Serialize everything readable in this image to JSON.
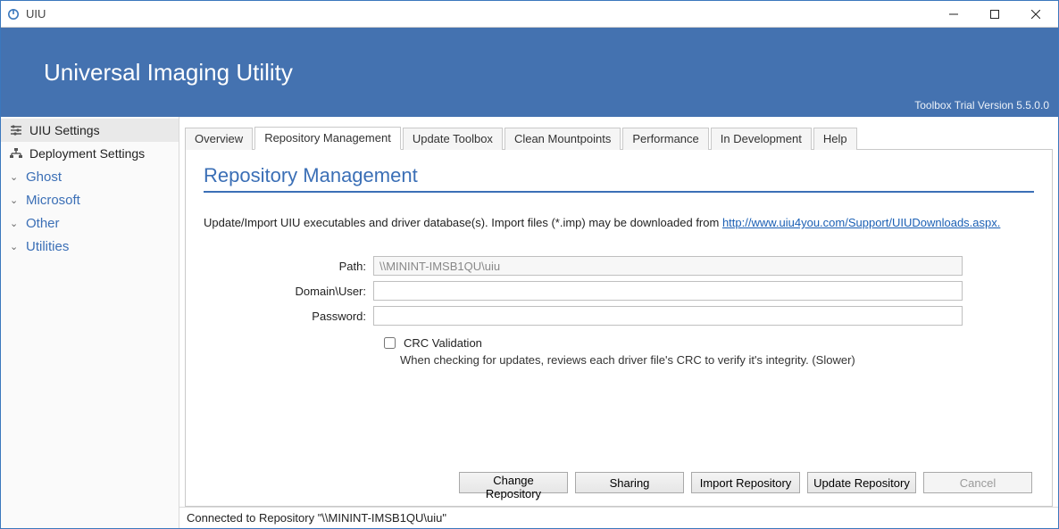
{
  "window": {
    "title": "UIU"
  },
  "banner": {
    "title": "Universal Imaging Utility",
    "version": "Toolbox Trial Version 5.5.0.0"
  },
  "sidebar": {
    "items": [
      {
        "label": "UIU Settings"
      },
      {
        "label": "Deployment Settings"
      }
    ],
    "groups": [
      {
        "label": "Ghost"
      },
      {
        "label": "Microsoft"
      },
      {
        "label": "Other"
      },
      {
        "label": "Utilities"
      }
    ]
  },
  "tabs": [
    {
      "label": "Overview"
    },
    {
      "label": "Repository Management"
    },
    {
      "label": "Update Toolbox"
    },
    {
      "label": "Clean Mountpoints"
    },
    {
      "label": "Performance"
    },
    {
      "label": "In Development"
    },
    {
      "label": "Help"
    }
  ],
  "page": {
    "title": "Repository Management",
    "intro_pre": "Update/Import UIU executables and driver database(s). Import files (*.imp) may be downloaded from ",
    "intro_link_text": "http://www.uiu4you.com/Support/UIUDownloads.aspx.",
    "intro_link_href": "http://www.uiu4you.com/Support/UIUDownloads.aspx",
    "form": {
      "path_label": "Path:",
      "path_value": "\\\\MININT-IMSB1QU\\uiu",
      "user_label": "Domain\\User:",
      "user_value": "",
      "pass_label": "Password:",
      "pass_value": "",
      "crc_label": "CRC Validation",
      "crc_checked": false,
      "crc_desc": "When checking for updates, reviews each driver file's CRC to verify it's integrity. (Slower)"
    },
    "buttons": {
      "change": "Change Repository",
      "sharing": "Sharing",
      "import": "Import Repository",
      "update": "Update Repository",
      "cancel": "Cancel"
    }
  },
  "status": {
    "text": "Connected to Repository \"\\\\MININT-IMSB1QU\\uiu\""
  }
}
